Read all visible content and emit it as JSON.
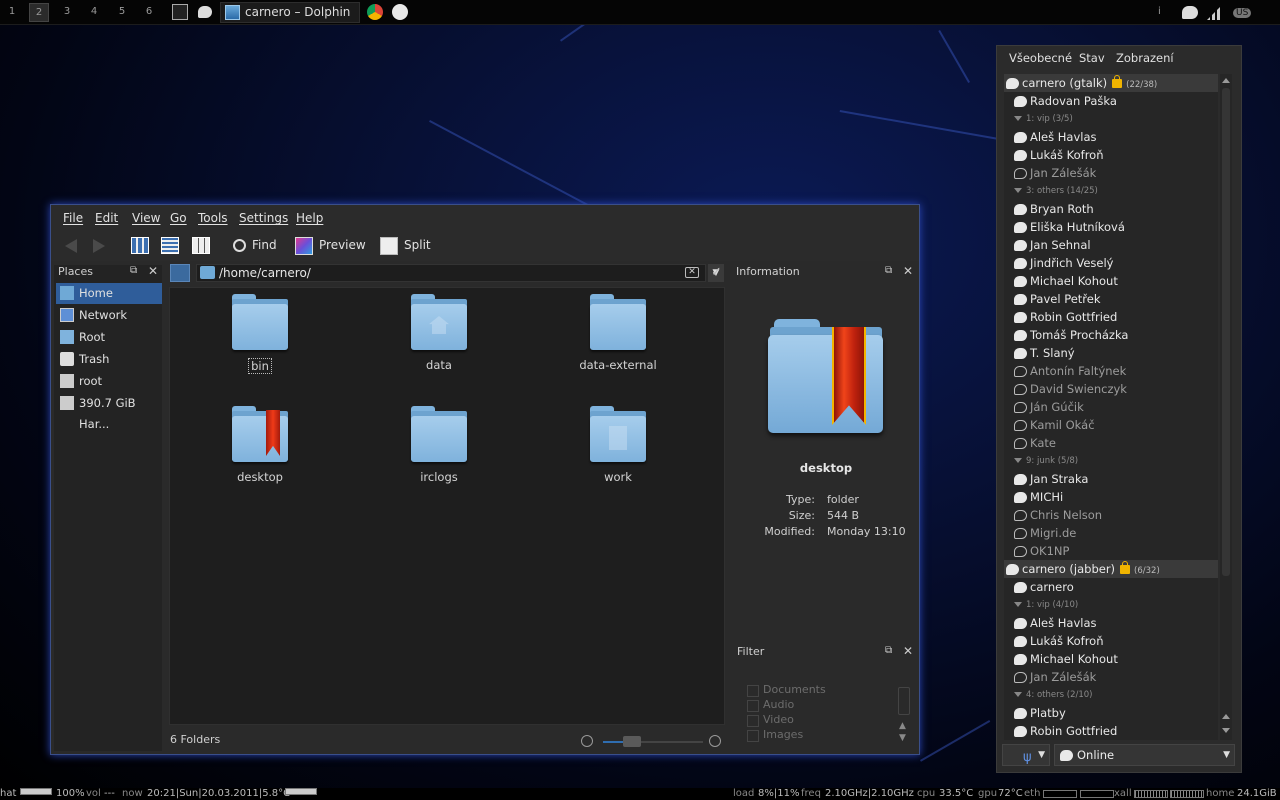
{
  "topbar": {
    "workspaces": [
      "1",
      "2",
      "3",
      "4",
      "5",
      "6"
    ],
    "task_title": "carnero – Dolphin",
    "tray_layout": "US",
    "tray_info": "i"
  },
  "bottombar": {
    "chat_label": "hat",
    "volume": "100%",
    "vol_label": "vol",
    "now_playing": "---",
    "now_label": "now",
    "datetime": "20:21|Sun|20.03.2011|5.8°C",
    "load_label": "load",
    "load": "8%|11%",
    "freq_label": "freq",
    "freq": "2.10GHz|2.10GHz",
    "cpu_label": "cpu",
    "cpu_temp": "33.5°C",
    "gpu_label": "gpu",
    "gpu_temp": "72°C",
    "eth_label": "eth",
    "xall_label": "xall",
    "home_label": "home",
    "home_free": "24.1GiB",
    "gauges": {
      "volume": 1.0,
      "vol2": 1.0
    }
  },
  "dolphin": {
    "menu": [
      "File",
      "Edit",
      "View",
      "Go",
      "Tools",
      "Settings",
      "Help"
    ],
    "toolbar": {
      "find": "Find",
      "preview": "Preview",
      "split": "Split"
    },
    "places_title": "Places",
    "places": [
      {
        "label": "Home",
        "icon": "home-icon",
        "selected": true
      },
      {
        "label": "Network",
        "icon": "network-icon"
      },
      {
        "label": "Root",
        "icon": "folder-icon"
      },
      {
        "label": "Trash",
        "icon": "trash-icon"
      },
      {
        "label": "root",
        "icon": "drive-icon"
      },
      {
        "label": "390.7 GiB Har...",
        "icon": "drive-icon"
      }
    ],
    "path": "/home/carnero/",
    "items": [
      {
        "label": "bin",
        "selected": true
      },
      {
        "label": "data",
        "emblem": "home-emblem"
      },
      {
        "label": "data-external"
      },
      {
        "label": "desktop",
        "emblem": "bookmark-ribbon"
      },
      {
        "label": "irclogs"
      },
      {
        "label": "work",
        "emblem": "document-emblem"
      }
    ],
    "status": "6 Folders",
    "zoom_level": 0.2,
    "info": {
      "title": "Information",
      "name": "desktop",
      "rows": [
        {
          "key": "Type:",
          "value": "folder"
        },
        {
          "key": "Size:",
          "value": "544 B"
        },
        {
          "key": "Modified:",
          "value": "Monday 13:10"
        }
      ]
    },
    "filter": {
      "title": "Filter",
      "options": [
        "Documents",
        "Audio",
        "Video",
        "Images"
      ]
    }
  },
  "kopete": {
    "menu": [
      "Všeobecné",
      "Stav",
      "Zobrazení"
    ],
    "rows": [
      {
        "type": "acct",
        "label": "carnero (gtalk)",
        "count": "(22/38)"
      },
      {
        "type": "contact",
        "label": "Radovan Paška"
      },
      {
        "type": "group",
        "label": "1: vip  (3/5)"
      },
      {
        "type": "contact",
        "label": "Aleš Havlas"
      },
      {
        "type": "contact",
        "label": "Lukáš Kofroň"
      },
      {
        "type": "off",
        "label": "Jan Zálešák"
      },
      {
        "type": "group",
        "label": "3: others  (14/25)"
      },
      {
        "type": "contact",
        "label": "Bryan Roth"
      },
      {
        "type": "contact",
        "label": "Eliška Hutníková"
      },
      {
        "type": "contact",
        "label": "Jan Sehnal"
      },
      {
        "type": "contact",
        "label": "Jindřich Veselý"
      },
      {
        "type": "contact",
        "label": "Michael Kohout"
      },
      {
        "type": "contact",
        "label": "Pavel Petřek"
      },
      {
        "type": "contact",
        "label": "Robin Gottfried"
      },
      {
        "type": "contact",
        "label": "Tomáš Procházka"
      },
      {
        "type": "contact",
        "label": "T. Slaný"
      },
      {
        "type": "off",
        "label": "Antonín Faltýnek"
      },
      {
        "type": "off",
        "label": "David Swienczyk"
      },
      {
        "type": "off",
        "label": "Ján Gúčik"
      },
      {
        "type": "off",
        "label": "Kamil Okáč"
      },
      {
        "type": "off",
        "label": "Kate"
      },
      {
        "type": "group",
        "label": "9: junk  (5/8)"
      },
      {
        "type": "contact",
        "label": "Jan Straka"
      },
      {
        "type": "contact",
        "label": "MICHi"
      },
      {
        "type": "off",
        "label": "Chris Nelson"
      },
      {
        "type": "off",
        "label": "Migri.de"
      },
      {
        "type": "off",
        "label": "OK1NP"
      },
      {
        "type": "acct",
        "label": "carnero (jabber)",
        "count": "(6/32)"
      },
      {
        "type": "contact",
        "label": "carnero"
      },
      {
        "type": "group",
        "label": "1: vip  (4/10)"
      },
      {
        "type": "contact",
        "label": "Aleš Havlas"
      },
      {
        "type": "contact",
        "label": "Lukáš Kofroň"
      },
      {
        "type": "contact",
        "label": "Michael Kohout"
      },
      {
        "type": "off",
        "label": "Jan Zálešák"
      },
      {
        "type": "group",
        "label": "4: others  (2/10)"
      },
      {
        "type": "contact",
        "label": "Platby"
      },
      {
        "type": "contact",
        "label": "Robin Gottfried"
      }
    ],
    "status": "Online"
  }
}
